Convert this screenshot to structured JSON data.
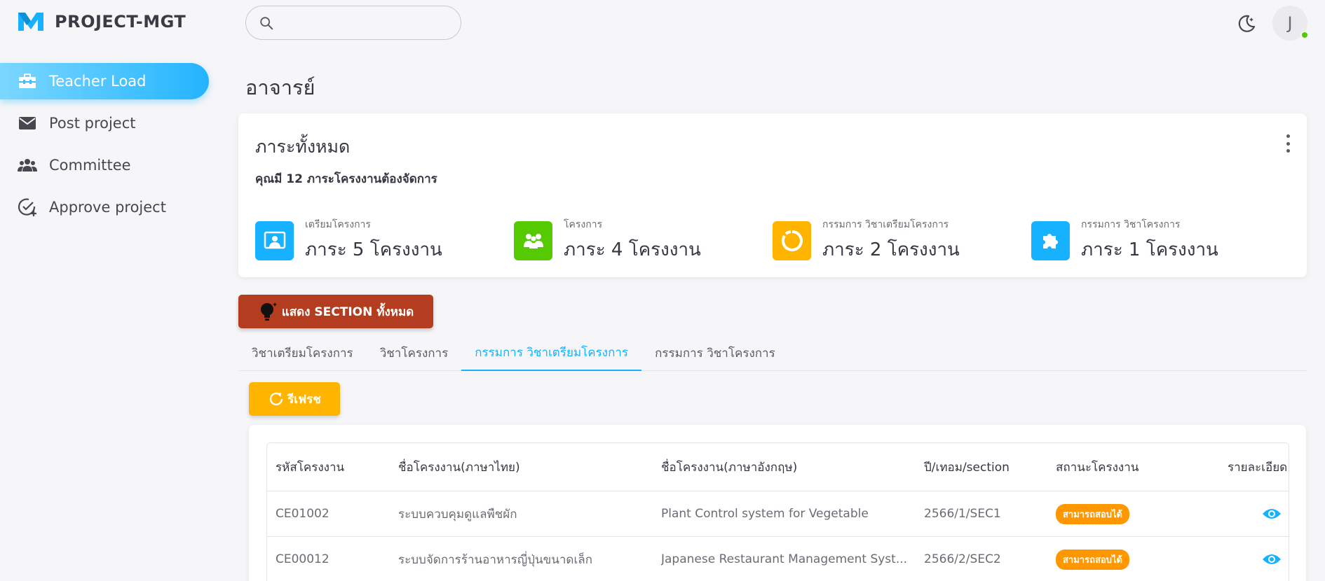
{
  "app": {
    "title": "PROJECT-MGT",
    "user_initial": "J",
    "brand_color": "#16b1ff",
    "search_placeholder": ""
  },
  "sidebar": {
    "items": [
      {
        "label": "Teacher Load",
        "icon": "briefcase-icon",
        "active": true
      },
      {
        "label": "Post project",
        "icon": "mail-icon"
      },
      {
        "label": "Committee",
        "icon": "group-icon"
      },
      {
        "label": "Approve project",
        "icon": "check-circle-plus-icon"
      }
    ]
  },
  "page": {
    "title": "อาจารย์"
  },
  "summary": {
    "title": "ภาระทั้งหมด",
    "subtitle": "คุณมี 12 ภาระโครงงานต้องจัดการ",
    "stats": [
      {
        "label": "เตรียมโครงการ",
        "value": "ภาระ 5 โครงงาน",
        "color": "#16b1ff",
        "icon": "presentation-icon"
      },
      {
        "label": "โครงการ",
        "value": "ภาระ 4 โครงงาน",
        "color": "#56ca00",
        "icon": "groups-icon"
      },
      {
        "label": "กรรมการ วิชาเตรียมโครงการ",
        "value": "ภาระ 2 โครงงาน",
        "color": "#ffb400",
        "icon": "donut-icon"
      },
      {
        "label": "กรรมการ วิชาโครงการ",
        "value": "ภาระ 1 โครงงาน",
        "color": "#16b1ff",
        "icon": "puzzle-icon"
      }
    ]
  },
  "section_button": {
    "label": "แสดง SECTION ทั้งหมด",
    "color": "#b33d1e"
  },
  "tabs": [
    {
      "label": "วิชาเตรียมโครงการ"
    },
    {
      "label": "วิชาโครงการ"
    },
    {
      "label": "กรรมการ วิชาเตรียมโครงการ",
      "active": true
    },
    {
      "label": "กรรมการ วิชาโครงการ"
    }
  ],
  "refresh_button": {
    "label": "รีเฟรช",
    "color": "#ffb400"
  },
  "table": {
    "columns": [
      "รหัสโครงงาน",
      "ชื่อโครงงาน(ภาษาไทย)",
      "ชื่อโครงงาน(ภาษาอังกฤษ)",
      "ปี/เทอม/section",
      "สถานะโครงงาน",
      "รายละเอียด"
    ],
    "rows": [
      {
        "code": "CE01002",
        "name_th": "ระบบควบคุมดูแลพืชผัก",
        "name_en": "Plant Control system for Vegetable",
        "term": "2566/1/SEC1",
        "status": "สามารถสอบได้"
      },
      {
        "code": "CE00012",
        "name_th": "ระบบจัดการร้านอาหารญี่ปุ่นขนาดเล็ก",
        "name_en": "Japanese Restaurant Management Syst...",
        "term": "2566/2/SEC2",
        "status": "สามารถสอบได้"
      }
    ]
  }
}
